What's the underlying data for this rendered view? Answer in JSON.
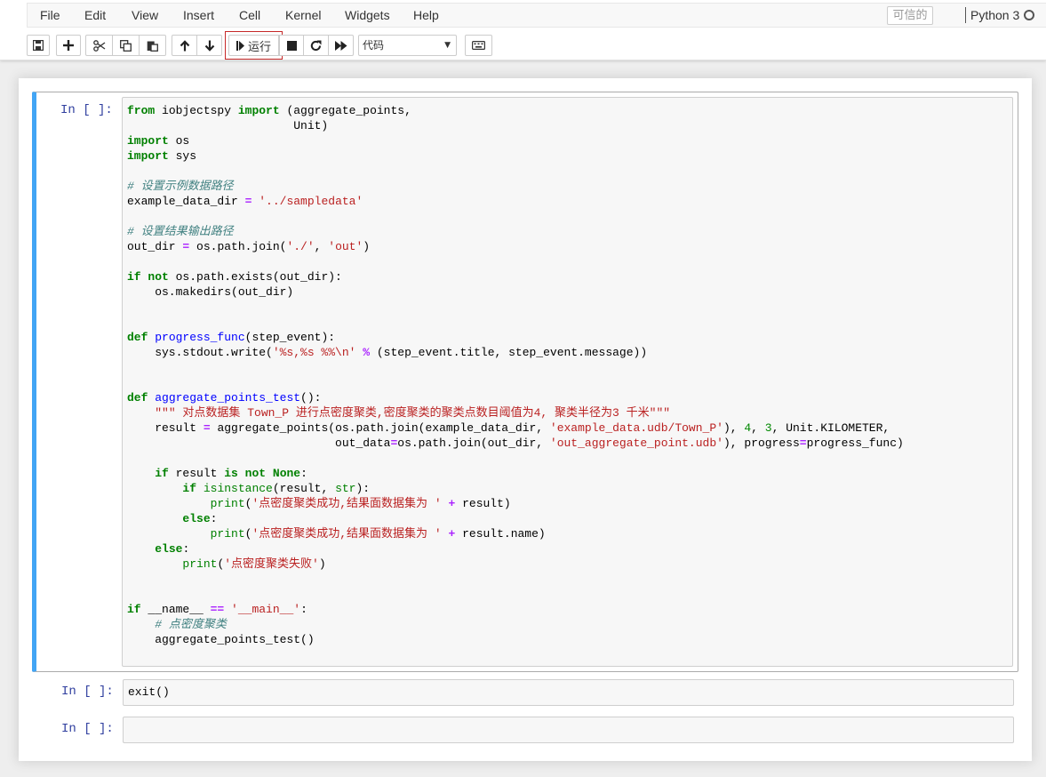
{
  "menu": {
    "items": [
      "File",
      "Edit",
      "View",
      "Insert",
      "Cell",
      "Kernel",
      "Widgets",
      "Help"
    ],
    "trusted": "可信的",
    "kernel_name": "Python 3"
  },
  "toolbar": {
    "run_label": "运行",
    "cell_type": "代码",
    "icons": [
      "save-icon",
      "plus-icon",
      "cut-icon",
      "copy-icon",
      "paste-icon",
      "arrow-up-icon",
      "arrow-down-icon",
      "step-forward-icon",
      "stop-icon",
      "refresh-icon",
      "fast-forward-icon",
      "keyboard-icon"
    ],
    "highlight_color": "#c62828"
  },
  "cells": [
    {
      "prompt": "In  [  ]:",
      "source": "from iobjectspy import (aggregate_points,\n                        Unit)\nimport os\nimport sys\n\n# 设置示例数据路径\nexample_data_dir = '../sampledata'\n\n# 设置结果输出路径\nout_dir = os.path.join('./', 'out')\n\nif not os.path.exists(out_dir):\n    os.makedirs(out_dir)\n\n\ndef progress_func(step_event):\n    sys.stdout.write('%s,%s %%\\n' % (step_event.title, step_event.message))\n\n\ndef aggregate_points_test():\n    \"\"\" 对点数据集 Town_P 进行点密度聚类,密度聚类的聚类点数目阈值为4, 聚类半径为3 千米\"\"\"\n    result = aggregate_points(os.path.join(example_data_dir, 'example_data.udb/Town_P'), 4, 3, Unit.KILOMETER,\n                              out_data=os.path.join(out_dir, 'out_aggregate_point.udb'), progress=progress_func)\n\n    if result is not None:\n        if isinstance(result, str):\n            print('点密度聚类成功,结果面数据集为 ' + result)\n        else:\n            print('点密度聚类成功,结果面数据集为 ' + result.name)\n    else:\n        print('点密度聚类失败')\n\n\nif __name__ == '__main__':\n    # 点密度聚类\n    aggregate_points_test()"
    },
    {
      "prompt": "In  [  ]:",
      "source": "exit()"
    },
    {
      "prompt": "In  [  ]:",
      "source": ""
    }
  ],
  "colors": {
    "selected_cell_bar": "#42a5f5",
    "prompt": "#303f9f"
  }
}
